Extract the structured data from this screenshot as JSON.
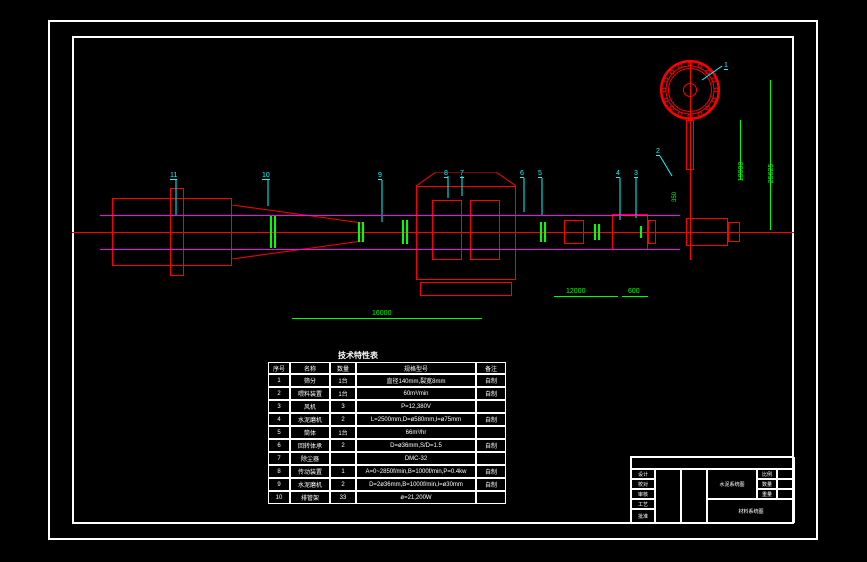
{
  "drawing": {
    "table_title": "技术特性表",
    "callouts": [
      "1",
      "2",
      "3",
      "4",
      "5",
      "6",
      "7",
      "8",
      "9",
      "10",
      "11"
    ],
    "dimensions": {
      "d1": "16000",
      "d2": "12000",
      "d3": "600",
      "d4": "10000",
      "d5": "350",
      "d6": "25625"
    }
  },
  "table": {
    "headers": [
      "序号",
      "名称",
      "数量",
      "规格型号",
      "备注"
    ],
    "rows": [
      [
        "1",
        "筛分",
        "1台",
        "直径140mm,裂宽8mm",
        "自制"
      ],
      [
        "2",
        "喂料装置",
        "1台",
        "60m³/min",
        "自制"
      ],
      [
        "3",
        "风机",
        "3",
        "P=12,380V",
        ""
      ],
      [
        "4",
        "水泥磨机",
        "2",
        "L=2500mm,D=ø580mm,l=ø75mm",
        "自制"
      ],
      [
        "5",
        "筒体",
        "1台",
        "66m³/hr",
        ""
      ],
      [
        "6",
        "回转体承",
        "2",
        "D=ø36mm,S/D=1.5",
        "自制"
      ],
      [
        "7",
        "除尘器",
        "",
        "DMC-32",
        ""
      ],
      [
        "8",
        "传动装置",
        "1",
        "A=0~2850f/min,B=1000f/min,P=0.4kw",
        "自制"
      ],
      [
        "9",
        "水泥磨机",
        "2",
        "D=2ø36mm,B=1000f/min,l=ø30mm",
        "自制"
      ],
      [
        "10",
        "排管架",
        "33",
        "ø=21,200W",
        ""
      ]
    ]
  },
  "title_block": {
    "labels": [
      "比例",
      "数量",
      "重量",
      "审核",
      "工艺",
      "批准",
      "设计",
      "校对"
    ],
    "drawing_name": "水泥系统图",
    "sheet": "材料系统图"
  }
}
